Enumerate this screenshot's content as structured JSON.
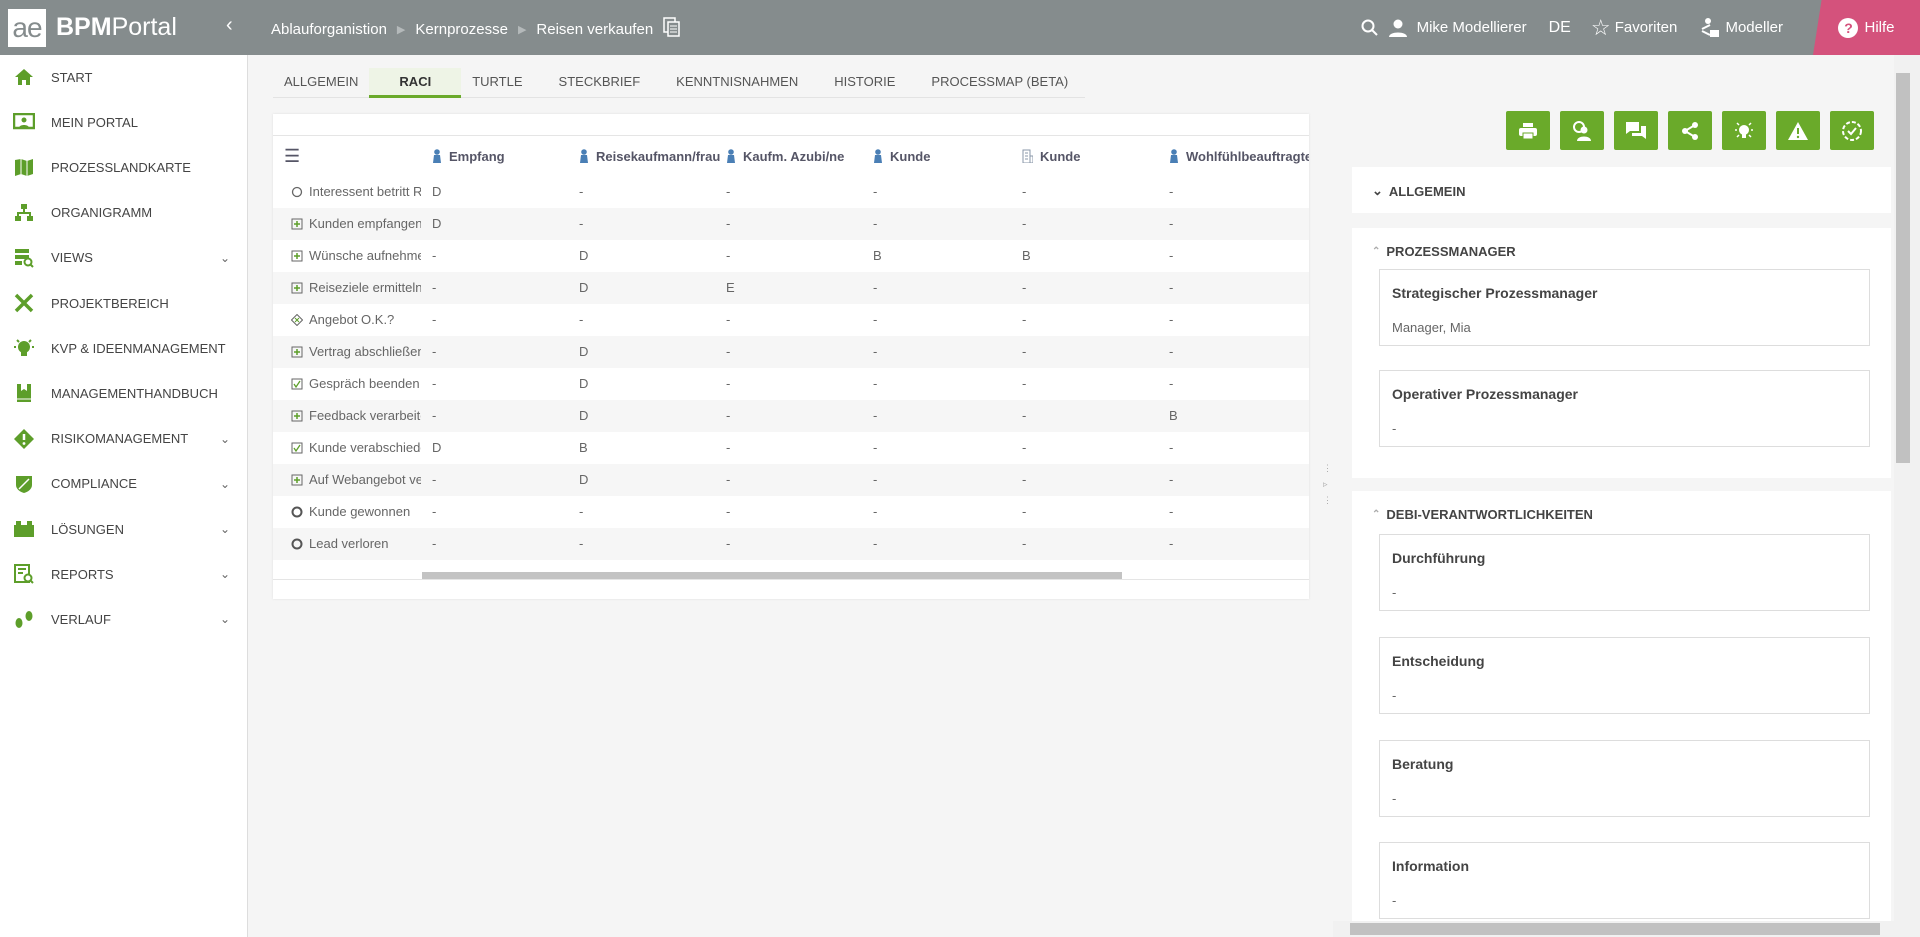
{
  "logo": {
    "ae": "ae",
    "bpm": "BPM",
    "portal": "Portal"
  },
  "breadcrumb": [
    "Ablauforganistion",
    "Kernprozesse",
    "Reisen verkaufen"
  ],
  "header": {
    "user": "Mike Modellierer",
    "lang": "DE",
    "favorites": "Favoriten",
    "modeller": "Modeller",
    "help": "Hilfe"
  },
  "sidebar": {
    "items": [
      {
        "label": "START",
        "icon": "home-icon"
      },
      {
        "label": "MEIN PORTAL",
        "icon": "portal-icon"
      },
      {
        "label": "PROZESSLANDKARTE",
        "icon": "map-icon"
      },
      {
        "label": "ORGANIGRAMM",
        "icon": "org-chart-icon"
      },
      {
        "label": "VIEWS",
        "icon": "views-icon",
        "expandable": true
      },
      {
        "label": "PROJEKTBEREICH",
        "icon": "tools-icon"
      },
      {
        "label": "KVP & IDEENMANAGEMENT",
        "icon": "lightbulb-icon"
      },
      {
        "label": "MANAGEMENTHANDBUCH",
        "icon": "book-icon"
      },
      {
        "label": "RISIKOMANAGEMENT",
        "icon": "risk-icon",
        "expandable": true
      },
      {
        "label": "COMPLIANCE",
        "icon": "shield-icon",
        "expandable": true
      },
      {
        "label": "LÖSUNGEN",
        "icon": "lego-icon",
        "expandable": true
      },
      {
        "label": "REPORTS",
        "icon": "report-icon",
        "expandable": true
      },
      {
        "label": "VERLAUF",
        "icon": "footsteps-icon",
        "expandable": true
      }
    ]
  },
  "tabs": [
    "ALLGEMEIN",
    "RACI",
    "TURTLE",
    "STECKBRIEF",
    "KENNTNISNAHMEN",
    "HISTORIE",
    "PROCESSMAP (BETA)"
  ],
  "active_tab": "RACI",
  "raci": {
    "columns": [
      {
        "label": "Empfang",
        "type": "role"
      },
      {
        "label": "Reisekaufmann/frau",
        "type": "role"
      },
      {
        "label": "Kaufm. Azubi/ne",
        "type": "role"
      },
      {
        "label": "Kunde",
        "type": "role"
      },
      {
        "label": "Kunde",
        "type": "org"
      },
      {
        "label": "Wohlfühlbeauftragte",
        "type": "role"
      }
    ],
    "rows": [
      {
        "label": "Interessent betritt Reisebüro",
        "icon": "event",
        "cells": [
          "D",
          "-",
          "-",
          "-",
          "-",
          "-"
        ]
      },
      {
        "label": "Kunden empfangen",
        "icon": "task",
        "cells": [
          "D",
          "-",
          "-",
          "-",
          "-",
          "-"
        ]
      },
      {
        "label": "Wünsche aufnehmen",
        "icon": "task",
        "cells": [
          "-",
          "D",
          "-",
          "B",
          "B",
          "-"
        ]
      },
      {
        "label": "Reiseziele ermitteln",
        "icon": "task",
        "cells": [
          "-",
          "D",
          "E",
          "-",
          "-",
          "-"
        ]
      },
      {
        "label": "Angebot O.K.?",
        "icon": "gateway",
        "cells": [
          "-",
          "-",
          "-",
          "-",
          "-",
          "-"
        ]
      },
      {
        "label": "Vertrag abschließen",
        "icon": "task",
        "cells": [
          "-",
          "D",
          "-",
          "-",
          "-",
          "-"
        ]
      },
      {
        "label": "Gespräch beenden",
        "icon": "check",
        "cells": [
          "-",
          "D",
          "-",
          "-",
          "-",
          "-"
        ]
      },
      {
        "label": "Feedback verarbeiten",
        "icon": "task",
        "cells": [
          "-",
          "D",
          "-",
          "-",
          "-",
          "B"
        ]
      },
      {
        "label": "Kunde verabschieden",
        "icon": "check",
        "cells": [
          "D",
          "B",
          "-",
          "-",
          "-",
          "-"
        ]
      },
      {
        "label": "Auf Webangebot verweisen",
        "icon": "task",
        "cells": [
          "-",
          "D",
          "-",
          "-",
          "-",
          "-"
        ]
      },
      {
        "label": "Kunde gewonnen",
        "icon": "end",
        "cells": [
          "-",
          "-",
          "-",
          "-",
          "-",
          "-"
        ]
      },
      {
        "label": "Lead verloren",
        "icon": "end",
        "cells": [
          "-",
          "-",
          "-",
          "-",
          "-",
          "-"
        ]
      }
    ]
  },
  "right": {
    "actions": [
      "print-icon",
      "user-feedback-icon",
      "comments-icon",
      "share-icon",
      "idea-icon",
      "warning-icon",
      "confirm-icon"
    ],
    "allgemein": "ALLGEMEIN",
    "prozessmanager": {
      "title": "PROZESSMANAGER",
      "items": [
        {
          "title": "Strategischer Prozessmanager",
          "value": "Manager, Mia"
        },
        {
          "title": "Operativer Prozessmanager",
          "value": "-"
        }
      ]
    },
    "debi": {
      "title": "DEBI-VERANTWORTLICHKEITEN",
      "items": [
        {
          "title": "Durchführung",
          "value": "-"
        },
        {
          "title": "Entscheidung",
          "value": "-"
        },
        {
          "title": "Beratung",
          "value": "-"
        },
        {
          "title": "Information",
          "value": "-"
        }
      ]
    }
  },
  "colors": {
    "header": "#858c8d",
    "accent": "#6aaa2a",
    "help": "#d4527c",
    "role": "#4a7fb5"
  }
}
